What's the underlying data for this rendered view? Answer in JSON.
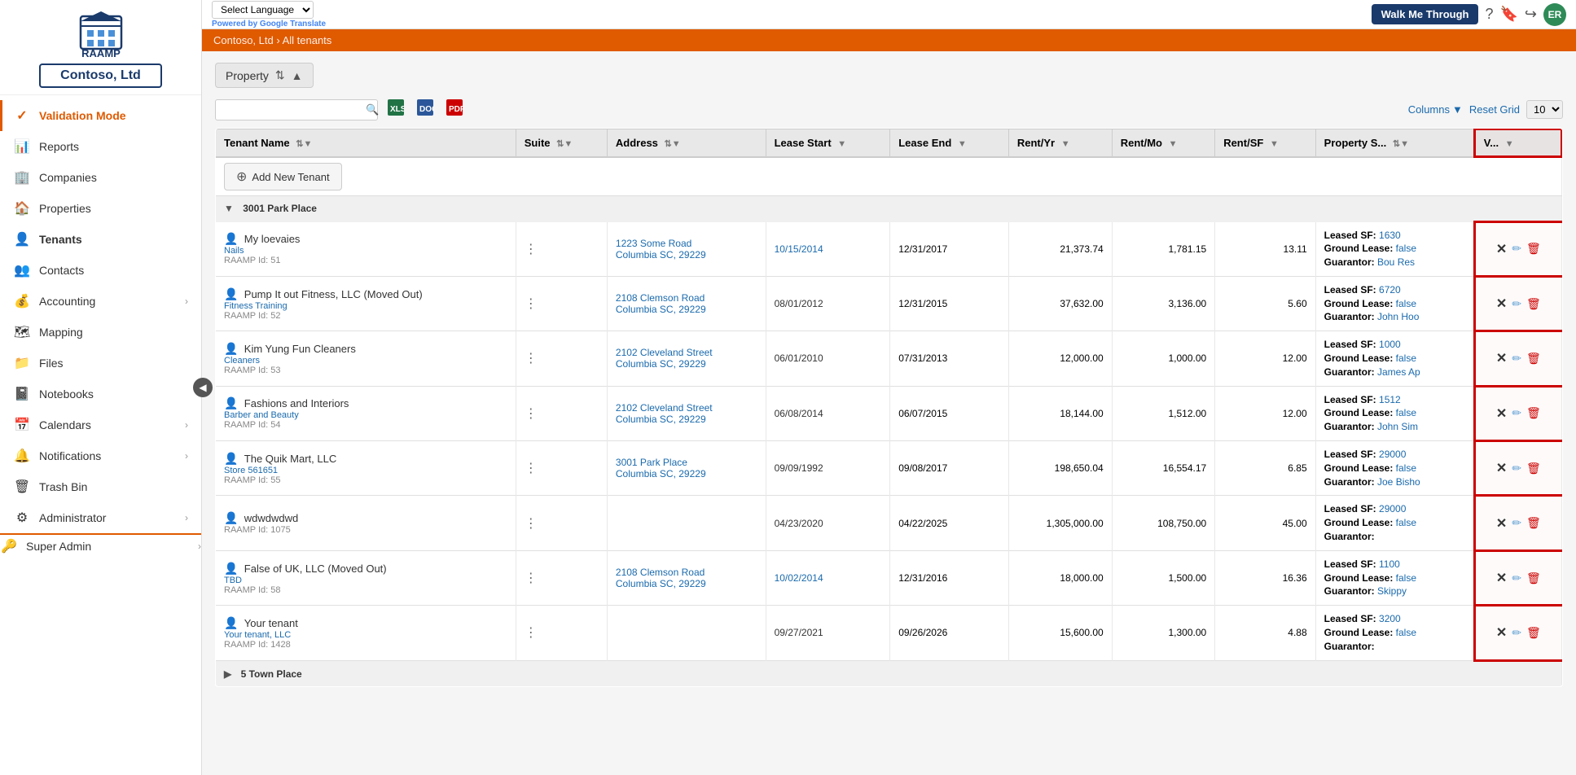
{
  "topbar": {
    "language_label": "Select Language",
    "powered_by": "Powered by",
    "google_text": "Google",
    "translate_text": "Translate",
    "walk_me_through": "Walk Me Through"
  },
  "sidebar": {
    "company_name": "Contoso, Ltd",
    "items": [
      {
        "id": "validation-mode",
        "label": "Validation Mode",
        "icon": "✓",
        "active": true,
        "hasArrow": false
      },
      {
        "id": "reports",
        "label": "Reports",
        "icon": "📊",
        "active": false,
        "hasArrow": false
      },
      {
        "id": "companies",
        "label": "Companies",
        "icon": "🏢",
        "active": false,
        "hasArrow": false
      },
      {
        "id": "properties",
        "label": "Properties",
        "icon": "🏠",
        "active": false,
        "hasArrow": false
      },
      {
        "id": "tenants",
        "label": "Tenants",
        "icon": "👤",
        "active": false,
        "hasArrow": false,
        "bold": true
      },
      {
        "id": "contacts",
        "label": "Contacts",
        "icon": "👥",
        "active": false,
        "hasArrow": false
      },
      {
        "id": "accounting",
        "label": "Accounting",
        "icon": "💰",
        "active": false,
        "hasArrow": true
      },
      {
        "id": "mapping",
        "label": "Mapping",
        "icon": "🗺",
        "active": false,
        "hasArrow": false
      },
      {
        "id": "files",
        "label": "Files",
        "icon": "📁",
        "active": false,
        "hasArrow": false
      },
      {
        "id": "notebooks",
        "label": "Notebooks",
        "icon": "📓",
        "active": false,
        "hasArrow": false
      },
      {
        "id": "calendars",
        "label": "Calendars",
        "icon": "📅",
        "active": false,
        "hasArrow": true
      },
      {
        "id": "notifications",
        "label": "Notifications",
        "icon": "🔔",
        "active": false,
        "hasArrow": true
      },
      {
        "id": "trash-bin",
        "label": "Trash Bin",
        "icon": "🗑",
        "active": false,
        "hasArrow": false
      },
      {
        "id": "administrator",
        "label": "Administrator",
        "icon": "⚙",
        "active": false,
        "hasArrow": true
      },
      {
        "id": "super-admin",
        "label": "Super Admin",
        "icon": "🔑",
        "active": false,
        "hasArrow": true
      }
    ]
  },
  "breadcrumb": {
    "company": "Contoso, Ltd",
    "separator": " › ",
    "page": "All tenants"
  },
  "toolbar": {
    "property_label": "Property",
    "add_new_label": "Add New Tenant",
    "columns_label": "Columns",
    "reset_grid_label": "Reset Grid",
    "page_size": "10",
    "search_placeholder": ""
  },
  "table": {
    "columns": [
      {
        "id": "tenant-name",
        "label": "Tenant Name",
        "sortable": true,
        "filterable": true
      },
      {
        "id": "suite",
        "label": "Suite",
        "sortable": true,
        "filterable": true
      },
      {
        "id": "address",
        "label": "Address",
        "sortable": true,
        "filterable": true
      },
      {
        "id": "lease-start",
        "label": "Lease Start",
        "sortable": false,
        "filterable": true
      },
      {
        "id": "lease-end",
        "label": "Lease End",
        "sortable": false,
        "filterable": true
      },
      {
        "id": "rent-yr",
        "label": "Rent/Yr",
        "sortable": false,
        "filterable": true
      },
      {
        "id": "rent-mo",
        "label": "Rent/Mo",
        "sortable": false,
        "filterable": true
      },
      {
        "id": "rent-sf",
        "label": "Rent/SF",
        "sortable": false,
        "filterable": true
      },
      {
        "id": "property-s",
        "label": "Property S...",
        "sortable": true,
        "filterable": true
      },
      {
        "id": "v",
        "label": "V...",
        "sortable": false,
        "filterable": true
      }
    ],
    "groups": [
      {
        "name": "3001 Park Place",
        "collapsed": false,
        "tenants": [
          {
            "name": "My loevaies",
            "subname": "Nails",
            "raamp_id": "RAAMP Id: 51",
            "suite": "",
            "address": "1223 Some Road",
            "address2": "Columbia SC, 29229",
            "lease_start": "10/15/2014",
            "lease_end": "12/31/2017",
            "rent_yr": "21,373.74",
            "rent_mo": "1,781.15",
            "rent_sf": "13.11",
            "property_s": "Leased SF: 1630\nGround Lease: false\nGuarantor: Bou Res",
            "v": ""
          },
          {
            "name": "Pump It out Fitness, LLC (Moved Out)",
            "subname": "Fitness Training",
            "raamp_id": "RAAMP Id: 52",
            "suite": "",
            "address": "2108 Clemson Road",
            "address2": "Columbia SC, 29229",
            "lease_start": "08/01/2012",
            "lease_end": "12/31/2015",
            "rent_yr": "37,632.00",
            "rent_mo": "3,136.00",
            "rent_sf": "5.60",
            "property_s": "Leased SF: 6720\nGround Lease: false\nGuarantor: John Hoo",
            "v": ""
          },
          {
            "name": "Kim Yung Fun Cleaners",
            "subname": "Cleaners",
            "raamp_id": "RAAMP Id: 53",
            "suite": "",
            "address": "2102 Cleveland Street",
            "address2": "Columbia SC, 29229",
            "lease_start": "06/01/2010",
            "lease_end": "07/31/2013",
            "rent_yr": "12,000.00",
            "rent_mo": "1,000.00",
            "rent_sf": "12.00",
            "property_s": "Leased SF: 1000\nGround Lease: false\nGuarantor: James Ap",
            "v": ""
          },
          {
            "name": "Fashions and Interiors",
            "subname": "Barber and Beauty",
            "raamp_id": "RAAMP Id: 54",
            "suite": "",
            "address": "2102 Cleveland Street",
            "address2": "Columbia SC, 29229",
            "lease_start": "06/08/2014",
            "lease_end": "06/07/2015",
            "rent_yr": "18,144.00",
            "rent_mo": "1,512.00",
            "rent_sf": "12.00",
            "property_s": "Leased SF: 1512\nGround Lease: false\nGuarantor: John Sim",
            "v": ""
          },
          {
            "name": "The Quik Mart, LLC",
            "subname": "Store 561651",
            "raamp_id": "RAAMP Id: 55",
            "suite": "",
            "address": "3001 Park Place",
            "address2": "Columbia SC, 29229",
            "lease_start": "09/09/1992",
            "lease_end": "09/08/2017",
            "rent_yr": "198,650.04",
            "rent_mo": "16,554.17",
            "rent_sf": "6.85",
            "property_s": "Leased SF: 29000\nGround Lease: false\nGuarantor: Joe Bisho",
            "v": ""
          },
          {
            "name": "wdwdwdwd",
            "subname": "",
            "raamp_id": "RAAMP Id: 1075",
            "suite": "",
            "address": "",
            "address2": "",
            "lease_start": "04/23/2020",
            "lease_end": "04/22/2025",
            "rent_yr": "1,305,000.00",
            "rent_mo": "108,750.00",
            "rent_sf": "45.00",
            "property_s": "Leased SF: 29000\nGround Lease: false\nGuarantor:",
            "v": ""
          },
          {
            "name": "False of UK, LLC (Moved Out)",
            "subname": "TBD",
            "raamp_id": "RAAMP Id: 58",
            "suite": "",
            "address": "2108 Clemson Road",
            "address2": "Columbia SC, 29229",
            "lease_start": "10/02/2014",
            "lease_end": "12/31/2016",
            "rent_yr": "18,000.00",
            "rent_mo": "1,500.00",
            "rent_sf": "16.36",
            "property_s": "Leased SF: 1100\nGround Lease: false\nGuarantor: Skippy",
            "v": ""
          },
          {
            "name": "Your tenant",
            "subname": "Your tenant, LLC",
            "raamp_id": "RAAMP Id: 1428",
            "suite": "",
            "address": "",
            "address2": "",
            "lease_start": "09/27/2021",
            "lease_end": "09/26/2026",
            "rent_yr": "15,600.00",
            "rent_mo": "1,300.00",
            "rent_sf": "4.88",
            "property_s": "Leased SF: 3200\nGround Lease: false\nGuarantor:",
            "v": ""
          }
        ]
      },
      {
        "name": "5 Town Place",
        "collapsed": true,
        "tenants": []
      }
    ]
  },
  "user": {
    "initials": "ER"
  }
}
